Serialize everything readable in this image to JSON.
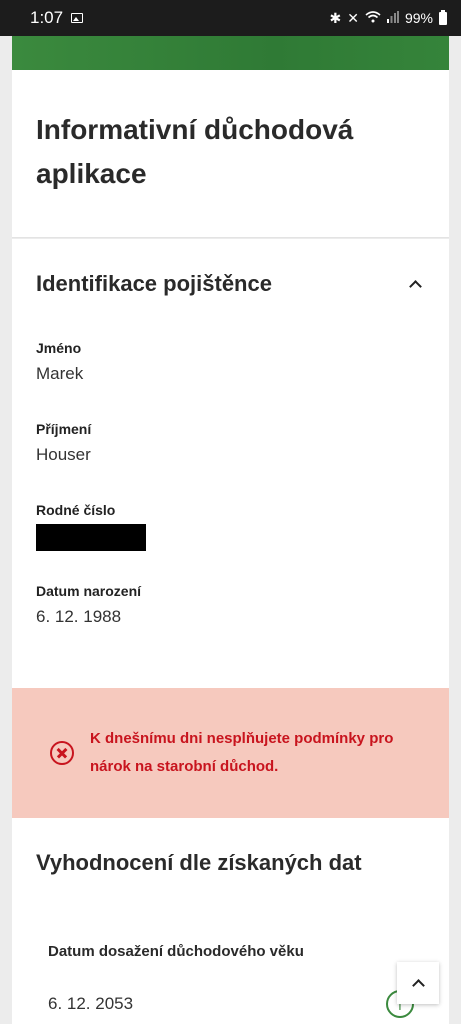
{
  "status_bar": {
    "time": "1:07",
    "icons_right": [
      "bluetooth-icon",
      "mute-icon",
      "wifi-icon",
      "signal-icon"
    ],
    "battery": "99%"
  },
  "title_card": {
    "title_line1": "Informativní důchodová",
    "title_line2": "aplikace"
  },
  "identification": {
    "heading": "Identifikace pojištěnce",
    "first_name_label": "Jméno",
    "first_name_value": "Marek",
    "last_name_label": "Příjmení",
    "last_name_value": "Houser",
    "birth_number_label": "Rodné číslo",
    "birth_date_label": "Datum narození",
    "birth_date_value": "6. 12. 1988"
  },
  "alert": {
    "text": "K dnešnímu dni nesplňujete podmínky pro nárok na starobní důchod.",
    "color": "#c8141e",
    "background": "#f6c9be"
  },
  "evaluation": {
    "heading": "Vyhodnocení dle získaných dat",
    "retirement_date_label": "Datum dosažení důchodového věku",
    "retirement_date_value": "6. 12. 2053"
  },
  "colors": {
    "brand_green": "#3b8a3e"
  }
}
